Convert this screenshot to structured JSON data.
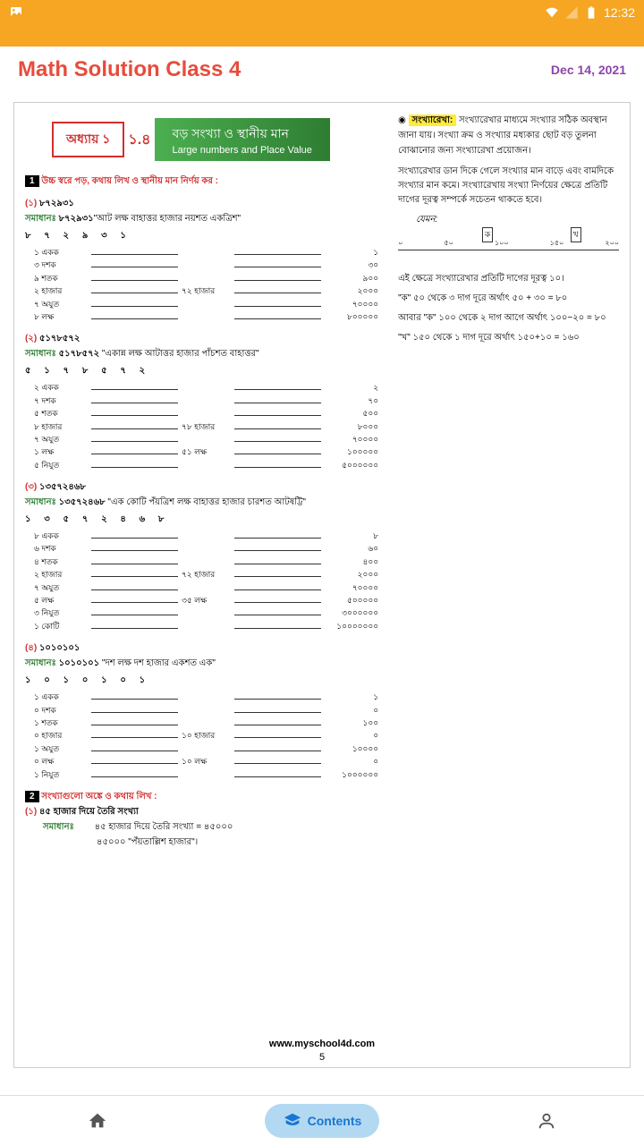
{
  "status": {
    "time": "12:32"
  },
  "header": {
    "title": "Math Solution Class 4",
    "date": "Dec 14, 2021"
  },
  "chapter": {
    "badge": "অধ্যায় ১",
    "num": "১.৪",
    "title_bn": "বড় সংখ্যা ও স্থানীয় মান",
    "title_en": "Large numbers and Place Value"
  },
  "section1": {
    "badge": "1",
    "title": "উচ্চ স্বরে পড়, কথায় লিখ ও স্থানীয় মান নির্ণয় কর :"
  },
  "problems": [
    {
      "num": "(১)",
      "value": "৮৭২৯৩১",
      "sol_label": "সমাধানঃ",
      "sol_val": "৮৭২৯৩১",
      "sol_text": "\"আট লক্ষ বাহাত্তর হাজার নয়শত একত্রিশ\"",
      "digits": "৮ ৭ ২ ৯ ৩ ১",
      "places": [
        {
          "label": "১ একক",
          "val": "১",
          "group": ""
        },
        {
          "label": "৩ দশক",
          "val": "৩০",
          "group": ""
        },
        {
          "label": "৯ শতক",
          "val": "৯০০",
          "group": ""
        },
        {
          "label": "২ হাজার",
          "val": "২০০০",
          "group": "৭২ হাজার"
        },
        {
          "label": "৭ অযুত",
          "val": "৭০০০০",
          "group": ""
        },
        {
          "label": "৮ লক্ষ",
          "val": "৮০০০০০",
          "group": ""
        }
      ]
    },
    {
      "num": "(২)",
      "value": "৫১৭৮৫৭২",
      "sol_label": "সমাধানঃ",
      "sol_val": "৫১৭৮৫৭২",
      "sol_text": " \"একান্ন লক্ষ আটাত্তর হাজার পাঁচশত বাহাত্তর\"",
      "digits": "৫ ১ ৭ ৮ ৫ ৭ ২",
      "places": [
        {
          "label": "২ একক",
          "val": "২",
          "group": ""
        },
        {
          "label": "৭ দশক",
          "val": "৭০",
          "group": ""
        },
        {
          "label": "৫ শতক",
          "val": "৫০০",
          "group": ""
        },
        {
          "label": "৮ হাজার",
          "val": "৮০০০",
          "group": "৭৮ হাজার"
        },
        {
          "label": "৭ অযুত",
          "val": "৭০০০০",
          "group": ""
        },
        {
          "label": "১ লক্ষ",
          "val": "১০০০০০",
          "group": "৫১ লক্ষ"
        },
        {
          "label": "৫ নিযুত",
          "val": "৫০০০০০০",
          "group": ""
        }
      ]
    },
    {
      "num": "(৩)",
      "value": "১৩৫৭২৪৬৮",
      "sol_label": "সমাধানঃ",
      "sol_val": "১৩৫৭২৪৬৮",
      "sol_text": " \"এক কোটি পঁয়ত্রিশ লক্ষ বাহাত্তর হাজার চারশত আটষট্টি\"",
      "digits": "১ ৩ ৫ ৭ ২ ৪ ৬ ৮",
      "places": [
        {
          "label": "৮ একক",
          "val": "৮",
          "group": ""
        },
        {
          "label": "৬ দশক",
          "val": "৬০",
          "group": ""
        },
        {
          "label": "৪ শতক",
          "val": "৪০০",
          "group": ""
        },
        {
          "label": "২ হাজার",
          "val": "২০০০",
          "group": "৭২ হাজার"
        },
        {
          "label": "৭ অযুত",
          "val": "৭০০০০",
          "group": ""
        },
        {
          "label": "৫ লক্ষ",
          "val": "৫০০০০০",
          "group": "৩৫ লক্ষ"
        },
        {
          "label": "৩ নিযুত",
          "val": "৩০০০০০০",
          "group": ""
        },
        {
          "label": "১ কোটি",
          "val": "১০০০০০০০",
          "group": ""
        }
      ]
    },
    {
      "num": "(৪)",
      "value": "১০১০১০১",
      "sol_label": "সমাধানঃ",
      "sol_val": "১০১০১০১",
      "sol_text": " \"দশ লক্ষ দশ হাজার একশত এক\"",
      "digits": "১ ০ ১ ০ ১ ০ ১",
      "places": [
        {
          "label": "১ একক",
          "val": "১",
          "group": ""
        },
        {
          "label": "০ দশক",
          "val": "০",
          "group": ""
        },
        {
          "label": "১ শতক",
          "val": "১০০",
          "group": ""
        },
        {
          "label": "০ হাজার",
          "val": "০",
          "group": "১০ হাজার"
        },
        {
          "label": "১ অযুত",
          "val": "১০০০০",
          "group": ""
        },
        {
          "label": "০ লক্ষ",
          "val": "০",
          "group": "১০ লক্ষ"
        },
        {
          "label": "১ নিযুত",
          "val": "১০০০০০০",
          "group": ""
        }
      ]
    }
  ],
  "section2": {
    "badge": "2",
    "title": "সংখ্যাগুলো অঙ্কে ও কথায় লিখ :",
    "p_num": "(১)",
    "p_text": "৪৫ হাজার দিয়ে তৈরি সংখ্যা",
    "sol_label": "সমাধানঃ",
    "sol1": "৪৫ হাজার দিয়ে তৈরি সংখ্যা = ৪৫০০০",
    "sol2": "৪৫০০০ \"পঁয়তাল্লিশ হাজার\"।"
  },
  "sidebar": {
    "badge": "◉",
    "title": "সংখ্যারেখা:",
    "p1": "সংখ্যারেখার মাধ্যমে সংখ্যার সঠিক অবস্থান জানা যায়। সংখ্যা ক্রম ও সংখ্যার মধ্যকার ছোট বড় তুলনা বোঝানোর জন্য সংখ্যারেখা প্রয়োজন।",
    "p2": "সংখ্যারেখার ডান দিকে গেলে সংখ্যার মান বাড়ে এবং বামদিকে সংখ্যার মান কমে। সংখ্যারেখায় সংখ্যা নির্ণয়ের ক্ষেত্রে প্রতিটি দাগের দূরত্ব সম্পর্কে সচেতন থাকতে হবে।",
    "example": "যেমন:",
    "ticks": [
      "০",
      "৫০",
      "১০০",
      "১৫০",
      "২০০"
    ],
    "marker_a": "ক",
    "marker_b": "খ",
    "p3": "এই ক্ষেত্রে সংখ্যারেখার প্রতিটি দাগের দূরত্ব ১০।",
    "p4": "\"ক\" ৫০ থেকে ৩ দাগ দূরে অর্থাৎ ৫০ + ৩০ = ৮০",
    "p5": "আবার \"ক\" ১০০ থেকে ২ দাগ আগে অর্থাৎ ১০০−২০ = ৮০",
    "p6": "\"খ\" ১৫০ থেকে ১ দাগ দূরে অর্থাৎ ১৫০+১০ = ১৬০"
  },
  "footer": {
    "url": "www.myschool4d.com",
    "page": "5"
  },
  "nav": {
    "contents": "Contents"
  }
}
